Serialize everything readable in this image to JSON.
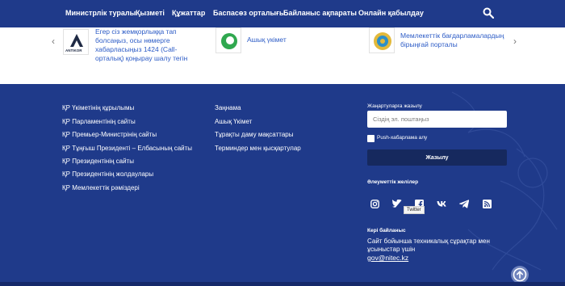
{
  "nav": {
    "items": [
      "Министрлік туралы",
      "Қызметі",
      "Құжаттар",
      "Баспасөз орталығы",
      "Байланыс ақпараты",
      "Онлайн қабылдау"
    ],
    "search_icon": "search-icon"
  },
  "carousel": {
    "prev_arrow": "‹",
    "next_arrow": "›",
    "partners": [
      {
        "logo_text": "ANTIKOR",
        "link": "Егер сіз жемқорлыққа тап болсаңыз, осы нөмерге хабарласыңыз 1424 (Call-орталық) қоңырау шалу тегін"
      },
      {
        "logo_text": "",
        "link": "Ашық үкімет"
      },
      {
        "logo_text": "",
        "link": "Мемлекеттік бағдарламалардың бірыңғай порталы"
      }
    ]
  },
  "footer": {
    "col1": [
      "ҚР Үкіметінің құрылымы",
      "ҚР Парламентінің сайты",
      "ҚР Премьер-Министрінің сайты",
      "ҚР Тұңғыш Президенті – Елбасының сайты",
      "ҚР Президентінің сайты",
      "ҚР Президентінің жолдаулары",
      "ҚР Мемлекеттік рәміздері"
    ],
    "col2": [
      "Заңнама",
      "Ашық Үкімет",
      "Тұрақты даму мақсаттары",
      "Терминдер мен қысқартулар"
    ],
    "subscribe": {
      "title": "Жаңартуларға жазылу",
      "placeholder": "Сіздің эл. поштаңыз",
      "push_label": "Push-хабарлама алу",
      "button": "Жазылу"
    },
    "social": {
      "title": "Әлеуметтік желілер",
      "icons": [
        "instagram-icon",
        "twitter-icon",
        "facebook-icon",
        "vk-icon",
        "telegram-icon",
        "rss-icon"
      ],
      "tooltip": "Twitter"
    },
    "contact": {
      "title": "Кері байланыс",
      "text": "Сайт бойынша техникалық сұрақтар мен ұсыныстар үшін",
      "email": "gov@nitec.kz"
    }
  },
  "colors": {
    "primary": "#1f3a8a",
    "button_dark": "#16295e",
    "link": "#2d5cc6"
  }
}
